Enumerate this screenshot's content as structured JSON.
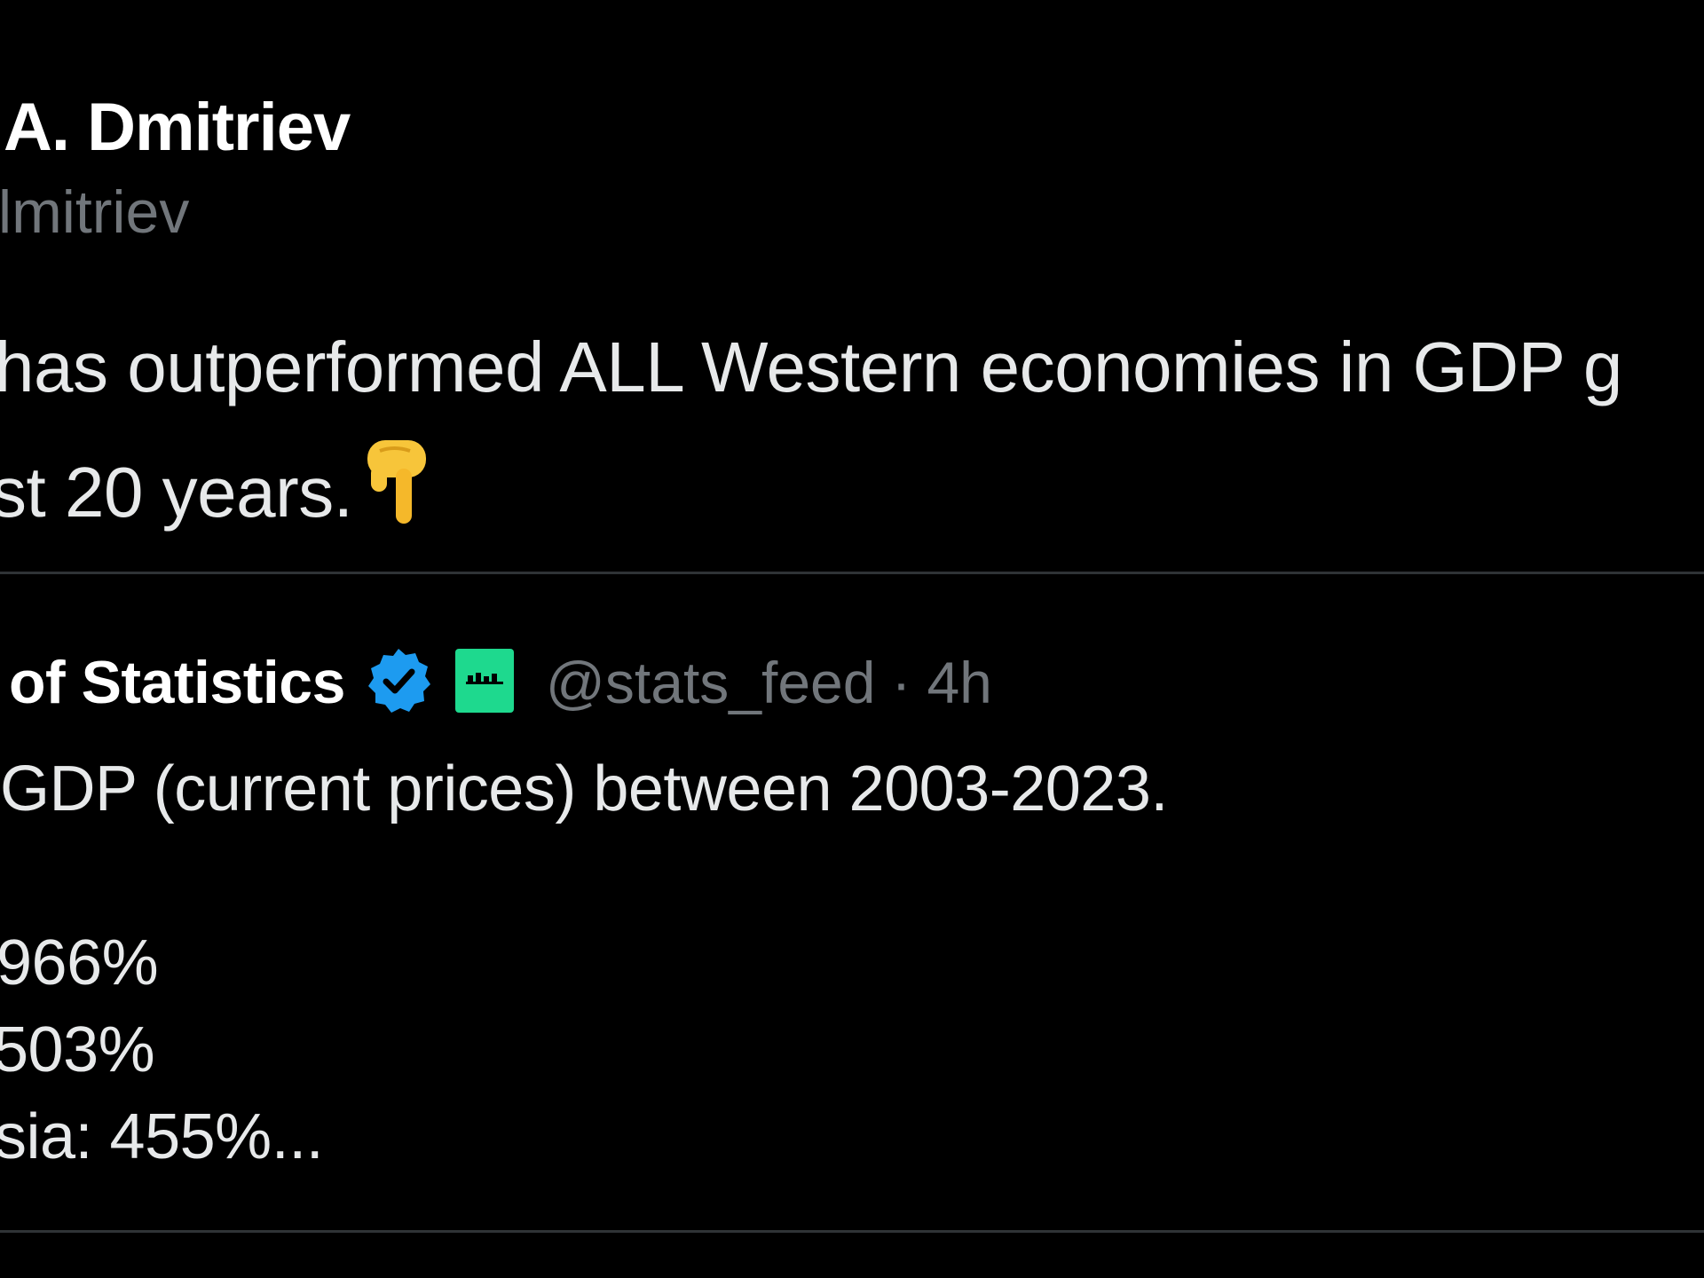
{
  "post": {
    "author_name": "A. Dmitriev",
    "author_handle": "lmitriev",
    "text_line_1": "has outperformed ALL Western economies in GDP g",
    "text_line_2": "st 20 years."
  },
  "quoted_post": {
    "author_name": "of Statistics",
    "handle": "@stats_feed",
    "separator": "·",
    "time": "4h",
    "lines": [
      "GDP (current prices) between 2003-2023.",
      "966%",
      "503%",
      "sia: 455%..."
    ]
  },
  "colors": {
    "background": "#000000",
    "primary_text": "#e7e9ea",
    "secondary_text": "#71767b",
    "divider": "#2f3336",
    "verified_badge": "#1d9bf0",
    "affiliate_badge": "#1ed98e"
  },
  "icons": [
    "backhand-index-pointing-down-icon",
    "verified-badge-icon",
    "affiliate-badge-icon"
  ]
}
